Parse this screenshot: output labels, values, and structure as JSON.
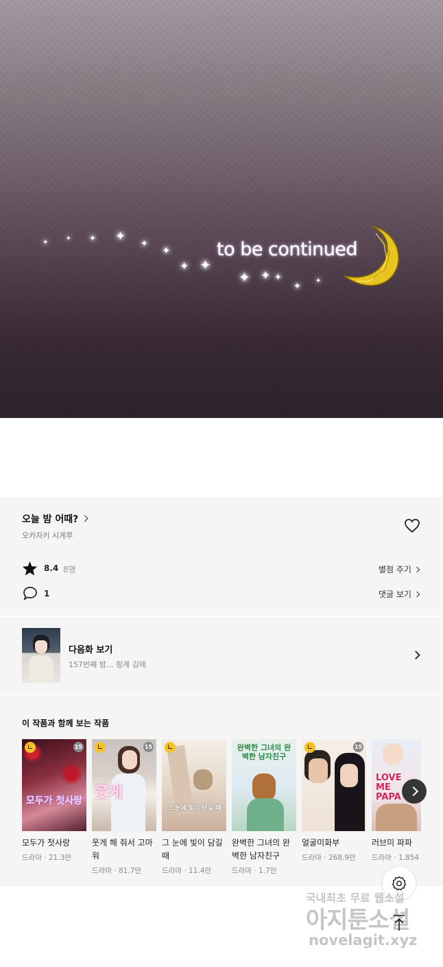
{
  "hero": {
    "caption": "to be continued"
  },
  "episode": {
    "title": "오늘 밤 어때?",
    "author": "오카자키 시게루",
    "rating": "8.4",
    "raters": "8명",
    "rate_link": "별점 주기",
    "comments": "1",
    "comments_link": "댓글 보기"
  },
  "next": {
    "label": "다음화 보기",
    "subtitle": "157번째 밤... 핑계 김에"
  },
  "recs": {
    "title": "이 작품과 함께 보는 작품",
    "items": [
      {
        "name": "모두가 첫사랑",
        "meta": "드라마 · 21.3만",
        "cover": "모두가 첫사랑",
        "age": "15"
      },
      {
        "name": "웃게 해 줘서 고마워",
        "meta": "드라마 · 81.7만",
        "cover": "웃게",
        "age": "15"
      },
      {
        "name": "그 눈에 빛이 담길 때",
        "meta": "드라마 · 11.4만",
        "cover": "그 눈에 빛이 담길 때"
      },
      {
        "name": "완벽한 그녀의 완벽한 남자친구",
        "meta": "드라마 · 1.7만",
        "cover": "완벽한 그녀의 완벽한 남자친구"
      },
      {
        "name": "얼굴미화부",
        "meta": "드라마 · 268.9만",
        "age": "15"
      },
      {
        "name": "러브미 파파",
        "meta": "드라마 · 1,854",
        "cover": "LOVE ME PAPA"
      }
    ]
  },
  "watermark": {
    "line1": "국내최초 무료 웹소설",
    "line2": "아지툰소설",
    "line3": "novelagit.xyz"
  },
  "colors": {
    "star": "#111111",
    "clock_badge": "#f3c12a",
    "panel_bg": "#f5f5f5"
  }
}
